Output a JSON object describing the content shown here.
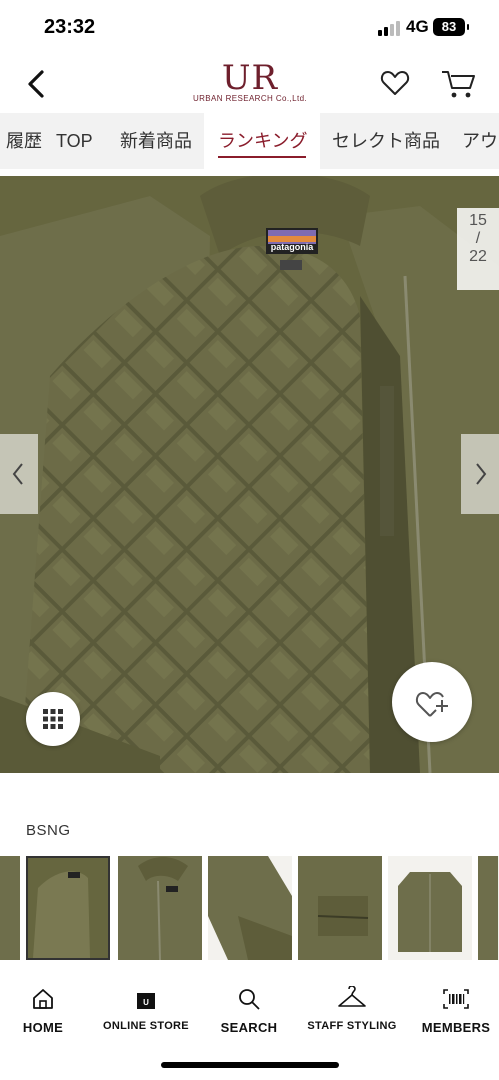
{
  "status_bar": {
    "time": "23:32",
    "network": "4G",
    "battery": "83"
  },
  "header": {
    "logo_text": "UR",
    "logo_subtext": "URBAN RESEARCH Co.,Ltd."
  },
  "tabs": [
    {
      "label": "履歴"
    },
    {
      "label": "TOP"
    },
    {
      "label": "新着商品"
    },
    {
      "label": "ランキング",
      "active": true
    },
    {
      "label": "セレクト商品"
    },
    {
      "label": "アウ"
    }
  ],
  "gallery": {
    "current": "15",
    "separator": "/",
    "total": "22",
    "brand_tag_text": "patagonia"
  },
  "product": {
    "color_name": "BSNG",
    "jacket_color": "#6b6b4a"
  },
  "thumbnails": [
    {
      "alt": "jacket-sleeve"
    },
    {
      "alt": "jacket-lining",
      "selected": true
    },
    {
      "alt": "jacket-front-logo"
    },
    {
      "alt": "jacket-sleeve-detail"
    },
    {
      "alt": "jacket-pocket"
    },
    {
      "alt": "jacket-full"
    },
    {
      "alt": "jacket-edge"
    }
  ],
  "bottom_nav": [
    {
      "label": "HOME",
      "icon": "home-icon"
    },
    {
      "label": "ONLINE STORE",
      "icon": "shopping-bag-icon"
    },
    {
      "label": "SEARCH",
      "icon": "search-icon"
    },
    {
      "label": "STAFF STYLING",
      "icon": "hanger-icon"
    },
    {
      "label": "MEMBERS",
      "icon": "barcode-icon"
    }
  ]
}
